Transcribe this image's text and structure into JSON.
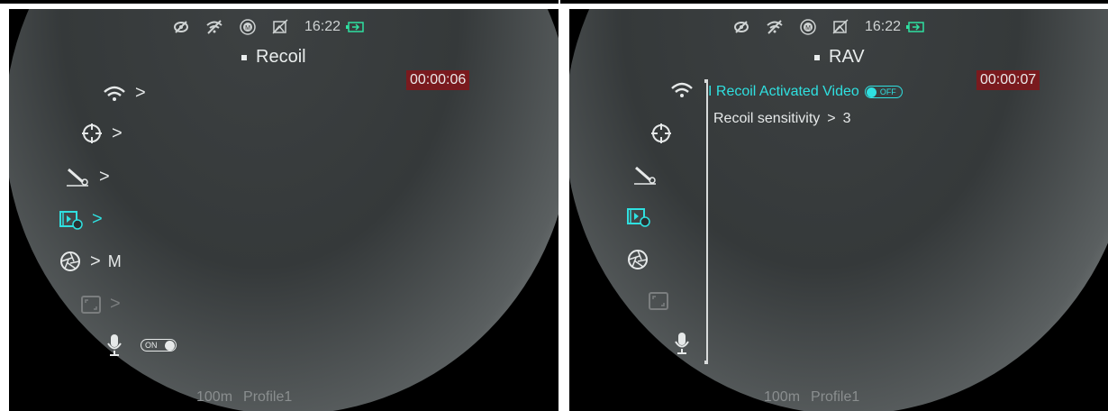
{
  "status_bar": {
    "icons": [
      "eye-off-icon",
      "wifi-off-icon",
      "m-mode-icon",
      "image-off-icon",
      "battery-charging-icon"
    ],
    "time": "16:22"
  },
  "left_screen": {
    "title": "Recoil",
    "timer": "00:00:06",
    "menu": [
      {
        "icon": "wifi-icon",
        "label": ">"
      },
      {
        "icon": "crosshair-icon",
        "label": ">"
      },
      {
        "icon": "scope-rifle-icon",
        "label": ">"
      },
      {
        "icon": "video-timer-icon",
        "label": ">",
        "active": true
      },
      {
        "icon": "aperture-icon",
        "label": ">",
        "value": "M"
      },
      {
        "icon": "frame-icon",
        "label": ">",
        "dim": true
      },
      {
        "icon": "microphone-icon",
        "toggle": "ON"
      }
    ],
    "footer": {
      "distance": "100m",
      "profile": "Profile1"
    }
  },
  "right_screen": {
    "title": "RAV",
    "timer": "00:00:07",
    "submenu": [
      {
        "label": "Recoil Activated Video",
        "toggle": "OFF",
        "selected": true
      },
      {
        "label": "Recoil sensitivity",
        "chevron": ">",
        "value": "3"
      }
    ],
    "footer": {
      "distance": "100m",
      "profile": "Profile1"
    }
  },
  "colors": {
    "accent": "#2fe0e0",
    "timer_bg": "#7a1a1e",
    "text": "#e6e9e9"
  }
}
